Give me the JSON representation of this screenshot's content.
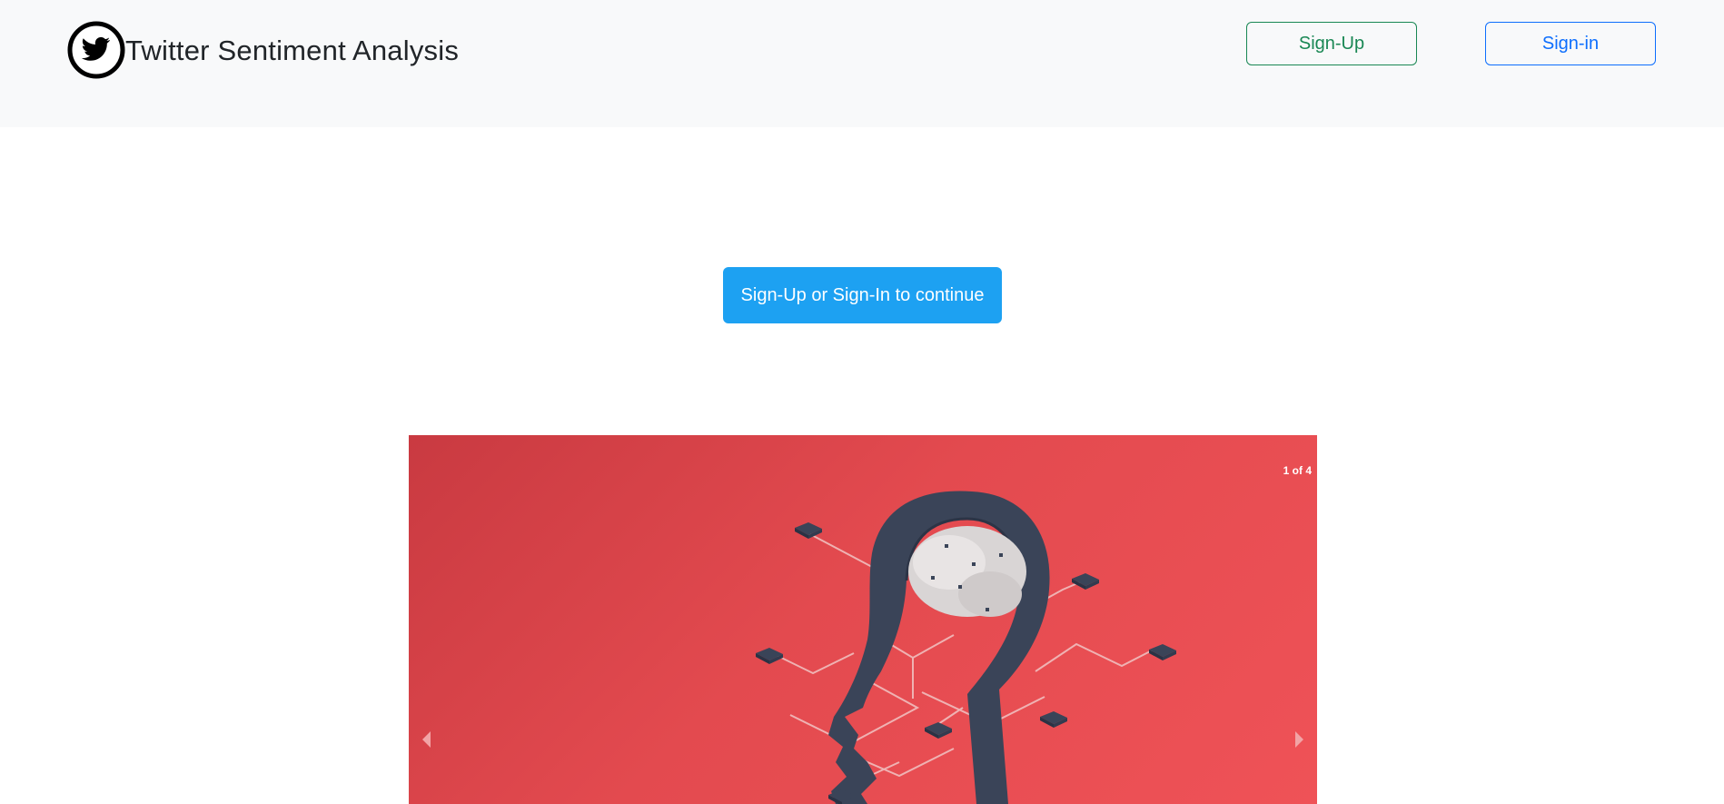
{
  "header": {
    "brand_title": "Twitter Sentiment Analysis",
    "logo_icon": "twitter-bird-circle-icon",
    "signup_label": "Sign-Up",
    "signin_label": "Sign-in"
  },
  "main": {
    "cta_label": "Sign-Up or Sign-In to continue"
  },
  "carousel": {
    "counter": "1 of 4",
    "prev_icon": "chevron-left-icon",
    "next_icon": "chevron-right-icon"
  },
  "colors": {
    "navbar_bg": "#f8f9fa",
    "signup": "#198754",
    "signin": "#0d6efd",
    "cta": "#1da1f2",
    "carousel_red": "#e34a4f"
  }
}
